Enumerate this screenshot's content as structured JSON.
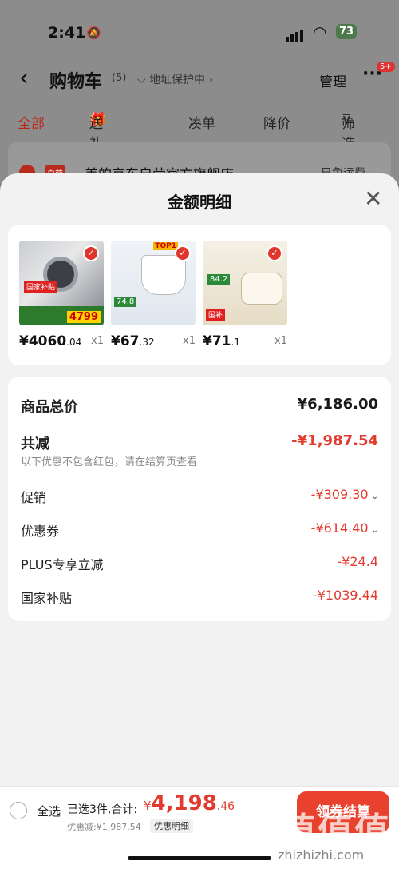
{
  "status": {
    "time": "2:41",
    "battery": "73"
  },
  "nav": {
    "title": "购物车",
    "count": "(5)",
    "address": "地址保护中",
    "manage": "管理",
    "badge": "5+"
  },
  "tabs": [
    "全部",
    "送礼",
    "凑单",
    "降价",
    "筛选"
  ],
  "store": {
    "tag": "自营",
    "name": "美的京东自营官方旗舰店",
    "shipping": "已免运费"
  },
  "sheet": {
    "title": "金额明细",
    "products": [
      {
        "price_main": "¥4060",
        "price_dec": ".04",
        "qty": "x1",
        "img_badge": "4799",
        "img_tag": "国家补贴"
      },
      {
        "price_main": "¥67",
        "price_dec": ".32",
        "qty": "x1",
        "img_badge": "TOP1",
        "img_tag": "74.8"
      },
      {
        "price_main": "¥71",
        "price_dec": ".1",
        "qty": "x1",
        "img_badge": "84.2",
        "img_tag": "国补"
      }
    ],
    "summary": {
      "total_label": "商品总价",
      "total_value": "¥6,186.00",
      "reduce_label": "共减",
      "reduce_value": "-¥1,987.54",
      "note": "以下优惠不包含红包，请在结算页查看",
      "promo_label": "促销",
      "promo_value": "-¥309.30",
      "coupon_label": "优惠券",
      "coupon_value": "-¥614.40",
      "plus_label": "PLUS专享立减",
      "plus_value": "-¥24.4",
      "subsidy_label": "国家补贴",
      "subsidy_value": "-¥1039.44"
    }
  },
  "bottom": {
    "select_all": "全选",
    "selected": "已选3件,合计:",
    "total_symbol": "¥",
    "total_int": "4,198",
    "total_dec": ".46",
    "discount": "优惠减:¥1,987.54",
    "detail": "优惠明细",
    "checkout": "领券结算"
  },
  "watermark": {
    "mark": "值",
    "site": "zhizhizhi.com"
  },
  "colors": {
    "accent": "#e23a2e",
    "checkout": "#e8412e"
  }
}
